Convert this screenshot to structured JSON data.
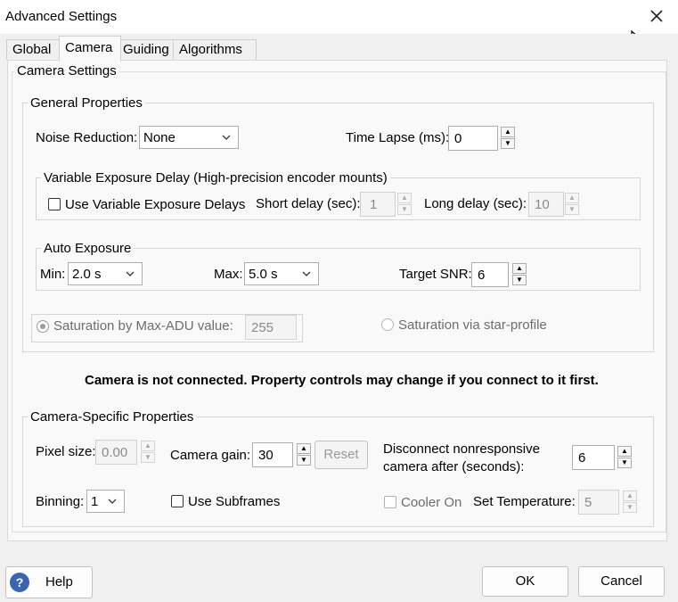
{
  "window": {
    "title": "Advanced Settings"
  },
  "tabs": [
    {
      "label": "Global"
    },
    {
      "label": "Camera"
    },
    {
      "label": "Guiding"
    },
    {
      "label": "Algorithms"
    }
  ],
  "camera_settings": {
    "label": "Camera Settings",
    "general": {
      "label": "General Properties",
      "noise_reduction_label": "Noise Reduction:",
      "noise_reduction_value": "None",
      "time_lapse_label": "Time Lapse (ms):",
      "time_lapse_value": "0",
      "variable_delay": {
        "label": "Variable Exposure Delay (High-precision encoder mounts)",
        "use_label": "Use Variable Exposure Delays",
        "short_label": "Short delay (sec):",
        "short_value": "1",
        "long_label": "Long delay (sec):",
        "long_value": "10"
      },
      "auto_exposure": {
        "label": "Auto Exposure",
        "min_label": "Min:",
        "min_value": "2.0 s",
        "max_label": "Max:",
        "max_value": "5.0 s",
        "snr_label": "Target SNR:",
        "snr_value": "6"
      },
      "saturation_adu_label": "Saturation by Max-ADU value:",
      "saturation_adu_value": "255",
      "saturation_star_label": "Saturation via star-profile"
    },
    "warning": "Camera is not connected.  Property controls may change if you connect to it first.",
    "specific": {
      "label": "Camera-Specific Properties",
      "pixel_size_label": "Pixel size:",
      "pixel_size_value": "0.00",
      "gain_label": "Camera gain:",
      "gain_value": "30",
      "reset_label": "Reset",
      "disconnect_label_1": "Disconnect nonresponsive",
      "disconnect_label_2": "camera after (seconds):",
      "disconnect_value": "6",
      "binning_label": "Binning:",
      "binning_value": "1",
      "subframes_label": "Use Subframes",
      "cooler_label": "Cooler On",
      "set_temp_label": "Set Temperature:",
      "set_temp_value": "5"
    }
  },
  "footer": {
    "help_label": "Help",
    "ok_label": "OK",
    "cancel_label": "Cancel"
  },
  "icons": {
    "close": "close-icon",
    "help": "help-icon",
    "chevron": "chevron-down-icon",
    "cursor": "mouse-cursor-icon"
  }
}
